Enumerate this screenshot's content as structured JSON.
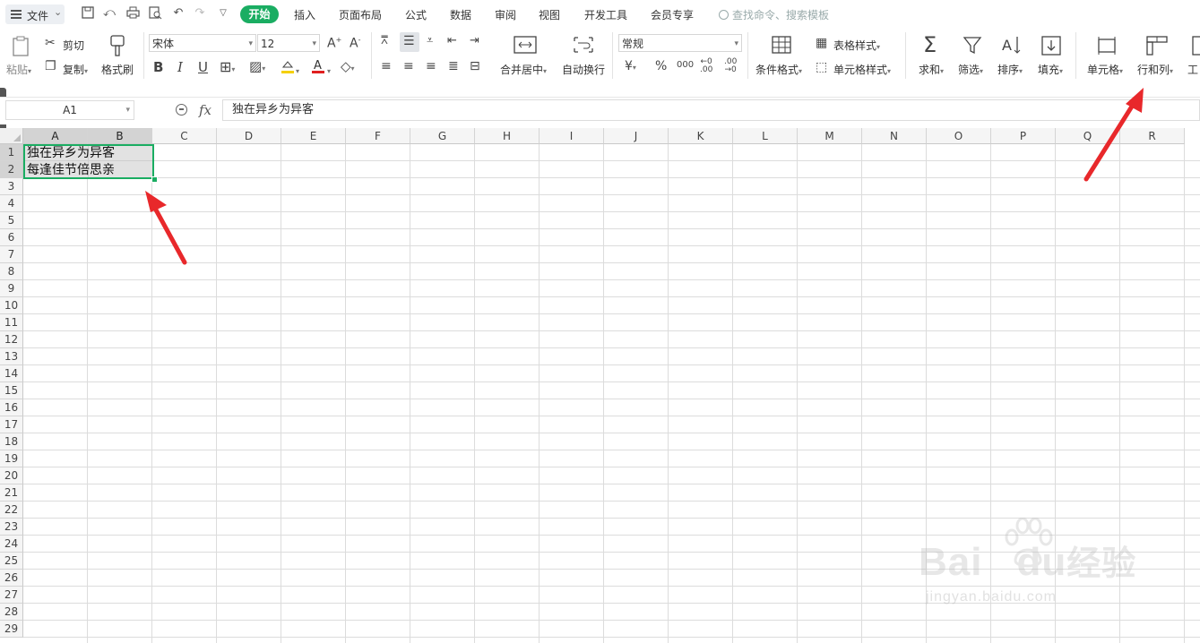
{
  "menu": {
    "file_label": "文件",
    "tabs": [
      "开始",
      "插入",
      "页面布局",
      "公式",
      "数据",
      "审阅",
      "视图",
      "开发工具",
      "会员专享"
    ],
    "search_placeholder": "查找命令、搜索模板"
  },
  "ribbon": {
    "paste": "粘贴",
    "cut": "剪切",
    "copy": "复制",
    "format_painter": "格式刷",
    "font_name": "宋体",
    "font_size": "12",
    "merge_center": "合并居中",
    "wrap_text": "自动换行",
    "number_format": "常规",
    "conditional_format": "条件格式",
    "table_style": "表格样式",
    "cell_style": "单元格样式",
    "sum": "求和",
    "filter": "筛选",
    "sort": "排序",
    "fill": "填充",
    "cell": "单元格",
    "row_col": "行和列",
    "worksheet_partial": "工"
  },
  "formula_bar": {
    "name_box": "A1",
    "fx": "fx",
    "content": "独在异乡为异客"
  },
  "sheet": {
    "columns": [
      "A",
      "B",
      "C",
      "D",
      "E",
      "F",
      "G",
      "H",
      "I",
      "J",
      "K",
      "L",
      "M",
      "N",
      "O",
      "P",
      "Q",
      "R"
    ],
    "rows": [
      "1",
      "2",
      "3",
      "4",
      "5",
      "6",
      "7",
      "8",
      "9",
      "10",
      "11",
      "12",
      "13",
      "14",
      "15",
      "16",
      "17",
      "18",
      "19",
      "20",
      "21",
      "22",
      "23",
      "24",
      "25",
      "26",
      "27",
      "28",
      "29"
    ],
    "cells": {
      "A1": "独在异乡为异客",
      "A2": "每逢佳节倍思亲"
    },
    "selection_color": "#1aad62"
  },
  "watermark": {
    "brand": "Bai",
    "brand2": "du",
    "brand_cn": "经验",
    "url": "jingyan.baidu.com"
  },
  "colors": {
    "accent": "#1aad62",
    "arrow": "#e8282b"
  }
}
